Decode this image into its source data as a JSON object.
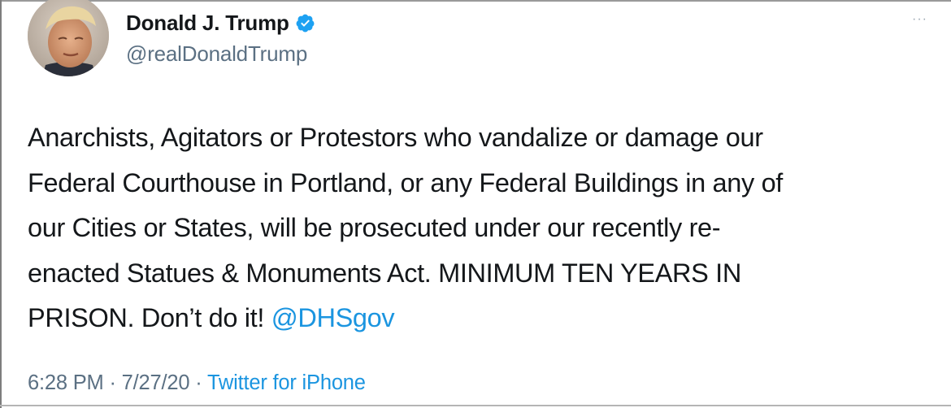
{
  "tweet": {
    "author": {
      "name": "Donald J. Trump",
      "handle": "@realDonaldTrump",
      "verified": true
    },
    "more_label": "···",
    "lines": [
      "Anarchists, Agitators or Protestors who vandalize or damage our",
      "Federal Courthouse in Portland, or any Federal Buildings in any of",
      "our Cities or States, will be prosecuted under our recently re-",
      "enacted Statues & Monuments Act. MINIMUM TEN YEARS IN"
    ],
    "last_line_text": "PRISON. Don’t do it! ",
    "mention": "@DHSgov",
    "time": "6:28 PM",
    "separator": " · ",
    "date": "7/27/20",
    "source": "Twitter for iPhone"
  },
  "colors": {
    "text": "#14171a",
    "secondary": "#5b7083",
    "link": "#1b95e0",
    "verified_badge": "#1da1f2"
  }
}
